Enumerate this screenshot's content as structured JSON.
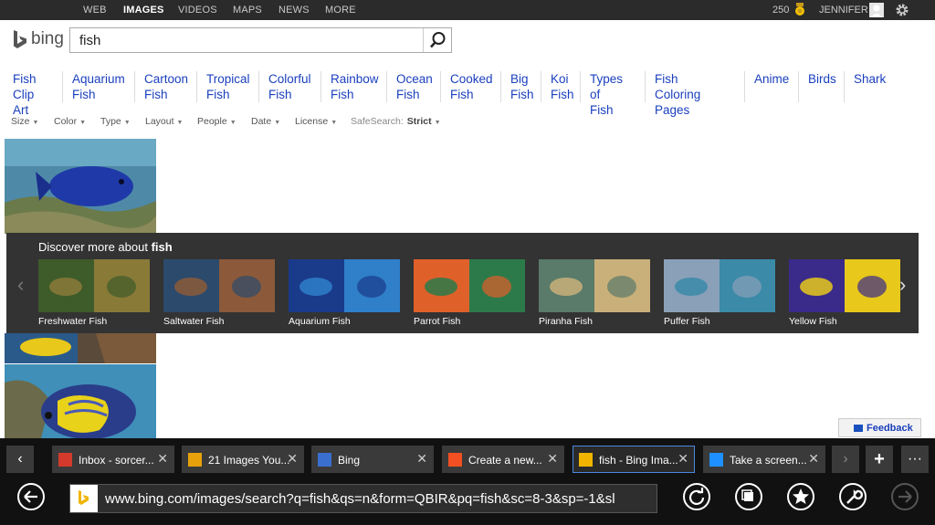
{
  "topnav": {
    "items": [
      "WEB",
      "IMAGES",
      "VIDEOS",
      "MAPS",
      "NEWS",
      "MORE"
    ],
    "active": "IMAGES"
  },
  "user": {
    "points": "250",
    "name": "JENNIFER"
  },
  "search": {
    "logo_text": "bing",
    "query": "fish"
  },
  "related": [
    {
      "l1": "Fish",
      "l2": "Clip Art"
    },
    {
      "l1": "Aquarium",
      "l2": "Fish"
    },
    {
      "l1": "Cartoon",
      "l2": "Fish"
    },
    {
      "l1": "Tropical",
      "l2": "Fish"
    },
    {
      "l1": "Colorful",
      "l2": "Fish"
    },
    {
      "l1": "Rainbow",
      "l2": "Fish"
    },
    {
      "l1": "Ocean",
      "l2": "Fish"
    },
    {
      "l1": "Cooked",
      "l2": "Fish"
    },
    {
      "l1": "Big",
      "l2": "Fish"
    },
    {
      "l1": "Koi",
      "l2": "Fish"
    },
    {
      "l1": "Types of",
      "l2": "Fish"
    },
    {
      "l1": "Fish",
      "l2": "Coloring Pages"
    },
    {
      "l1": "Anime",
      "l2": ""
    },
    {
      "l1": "Birds",
      "l2": ""
    },
    {
      "l1": "Shark",
      "l2": ""
    }
  ],
  "filters": {
    "items": [
      "Size",
      "Color",
      "Type",
      "Layout",
      "People",
      "Date",
      "License"
    ],
    "safesearch_label": "SafeSearch:",
    "safesearch_value": "Strict"
  },
  "discover": {
    "title_prefix": "Discover more about",
    "title_term": "fish",
    "items": [
      {
        "label": "Freshwater Fish",
        "c1": "#3e5b2a",
        "c2": "#8a7a38"
      },
      {
        "label": "Saltwater Fish",
        "c1": "#2c4a6b",
        "c2": "#8c5a3a"
      },
      {
        "label": "Aquarium Fish",
        "c1": "#1a3a8a",
        "c2": "#2f7fc9"
      },
      {
        "label": "Parrot Fish",
        "c1": "#e0602a",
        "c2": "#2c7a4a"
      },
      {
        "label": "Piranha Fish",
        "c1": "#5a7a6a",
        "c2": "#c9b07a"
      },
      {
        "label": "Puffer Fish",
        "c1": "#8aa0b8",
        "c2": "#3a8aa8"
      },
      {
        "label": "Yellow Fish",
        "c1": "#3a2a8a",
        "c2": "#e8c81a"
      }
    ]
  },
  "feedback": "Feedback",
  "tabs": [
    {
      "label": "Inbox - sorcer...",
      "icon": "gmail-icon",
      "color": "#d33a2c"
    },
    {
      "label": "21 Images You...",
      "icon": "site-icon",
      "color": "#e7a20b"
    },
    {
      "label": "Bing",
      "icon": "bing-m-icon",
      "color": "#3b6fcf"
    },
    {
      "label": "Create a new...",
      "icon": "windows-icon",
      "color": "#f25022"
    },
    {
      "label": "fish - Bing Ima...",
      "icon": "bing-icon",
      "color": "#f0b400"
    },
    {
      "label": "Take a screen...",
      "icon": "windows-icon",
      "color": "#1e90ff"
    }
  ],
  "address": {
    "url": "www.bing.com/images/search?q=fish&qs=n&form=QBIR&pq=fish&sc=8-3&sp=-1&sl"
  }
}
